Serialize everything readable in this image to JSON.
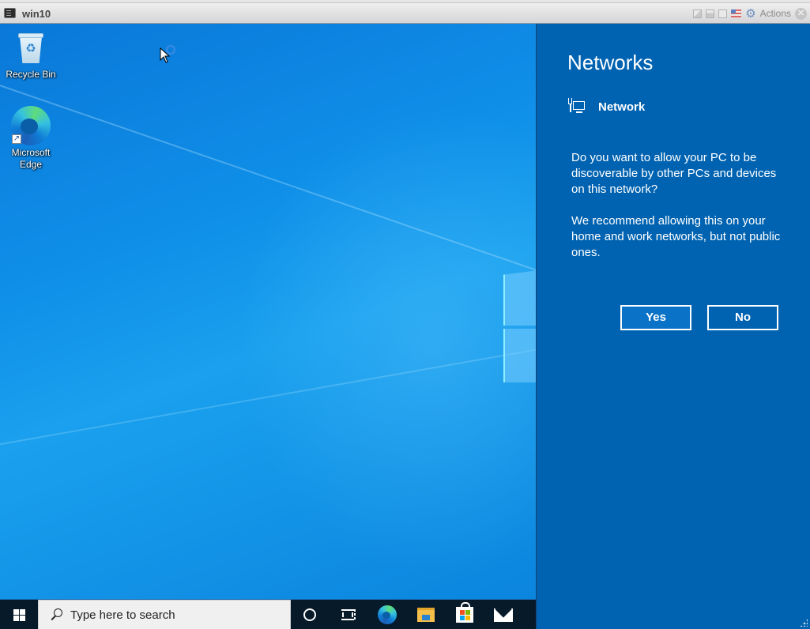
{
  "console": {
    "title": "win10",
    "actions_label": "Actions"
  },
  "desktop": {
    "icons": [
      {
        "label": "Recycle Bin",
        "icon": "recycle-bin-icon"
      },
      {
        "label": "Microsoft Edge",
        "icon": "edge-icon"
      }
    ]
  },
  "taskbar": {
    "search_placeholder": "Type here to search",
    "pinned": [
      "cortana",
      "task-view",
      "microsoft-edge",
      "file-explorer",
      "microsoft-store",
      "mail"
    ]
  },
  "flyout": {
    "title": "Networks",
    "network_name": "Network",
    "question": "Do you want to allow your PC to be discoverable by other PCs and devices on this network?",
    "recommendation": "We recommend allowing this on your home and work networks, but not public ones.",
    "yes_label": "Yes",
    "no_label": "No",
    "background_color": "#0063b1"
  }
}
